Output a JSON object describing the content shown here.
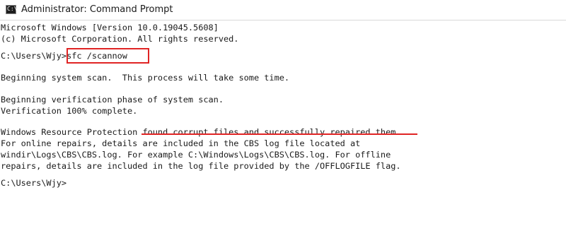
{
  "window": {
    "title": "Administrator: Command Prompt",
    "icon_name": "cmd-icon",
    "icon_glyph": "C:\\"
  },
  "console": {
    "lines": [
      "Microsoft Windows [Version 10.0.19045.5608]",
      "(c) Microsoft Corporation. All rights reserved.",
      "",
      "C:\\Users\\Wjy>sfc /scannow",
      "",
      "Beginning system scan.  This process will take some time.",
      "",
      "Beginning verification phase of system scan.",
      "Verification 100% complete.",
      "",
      "Windows Resource Protection found corrupt files and successfully repaired them.",
      "For online repairs, details are included in the CBS log file located at",
      "windir\\Logs\\CBS\\CBS.log. For example C:\\Windows\\Logs\\CBS\\CBS.log. For offline",
      "repairs, details are included in the log file provided by the /OFFLOGFILE flag.",
      "",
      "C:\\Users\\Wjy>"
    ]
  },
  "colors": {
    "highlight": "#e02424",
    "text": "#1a1a1a",
    "background": "#ffffff"
  }
}
